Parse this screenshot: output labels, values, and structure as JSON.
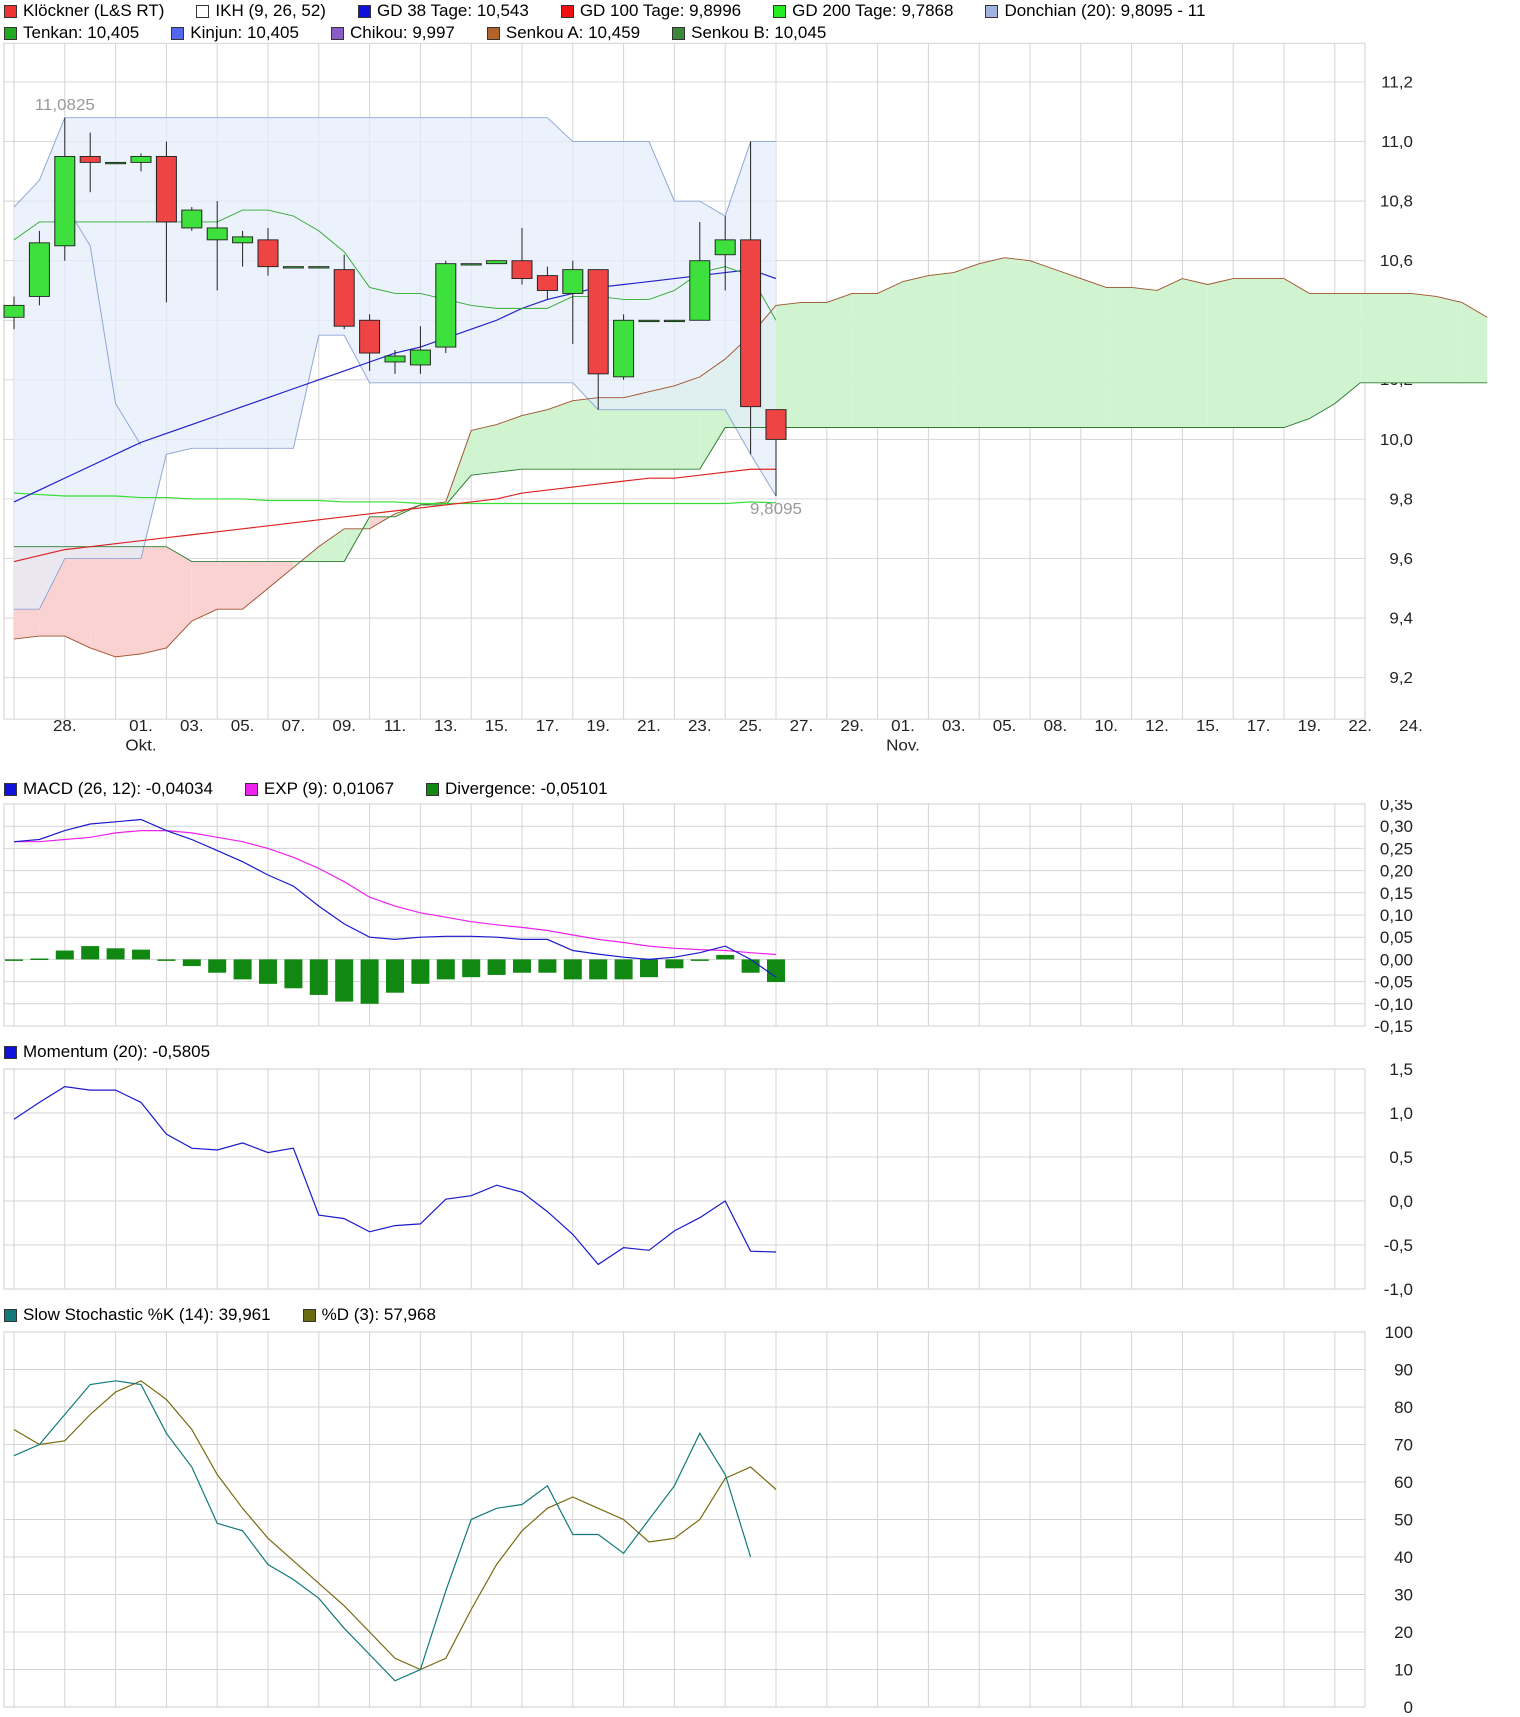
{
  "colors": {
    "bull": "#3de03d",
    "bear": "#ee4444",
    "gd38": "#2222cc",
    "gd100": "#dd2222",
    "gd200": "#33dd33",
    "donchian_fill": "#e6eefb",
    "donchian_line": "#8ea6d6",
    "tenkan": "#33aa33",
    "kumo_bull": "#d0f4d0",
    "kumo_bear": "#fbd2d2",
    "senkou_a": "#a0522d",
    "senkou_b": "#2e7d32",
    "macd": "#1a1acc",
    "exp": "#ee22ee",
    "divergence": "#118811",
    "momentum": "#1a1acc",
    "stoch_k": "#127a7a",
    "stoch_d": "#7a6a10",
    "grid": "#d4d4d4"
  },
  "legend": {
    "main_row1": [
      {
        "label": "Klöckner (L&S RT)",
        "color": "#ee3333"
      },
      {
        "label": "IKH (9, 26, 52)",
        "color": "#ffffff"
      },
      {
        "label": "GD 38 Tage: 10,543",
        "color": "#1111dd"
      },
      {
        "label": "GD 100 Tage: 9,8996",
        "color": "#ee1111"
      },
      {
        "label": "GD 200 Tage: 9,7868",
        "color": "#22ee22"
      },
      {
        "label": "Donchian (20): 9,8095 - 11",
        "color": "#9fb3dd"
      }
    ],
    "main_row2": [
      {
        "label": "Tenkan: 10,405",
        "color": "#22aa22"
      },
      {
        "label": "Kinjun: 10,405",
        "color": "#5566ee"
      },
      {
        "label": "Chikou: 9,997",
        "color": "#8a5cc8"
      },
      {
        "label": "Senkou A: 10,459",
        "color": "#b0642a"
      },
      {
        "label": "Senkou B: 10,045",
        "color": "#3a8a3a"
      }
    ],
    "macd": [
      {
        "label": "MACD (26, 12): -0,04034",
        "color": "#1111dd"
      },
      {
        "label": "EXP (9): 0,01067",
        "color": "#ee22ee"
      },
      {
        "label": "Divergence: -0,05101",
        "color": "#118811"
      }
    ],
    "momentum": [
      {
        "label": "Momentum (20): -0,5805",
        "color": "#1111dd"
      }
    ],
    "stoch": [
      {
        "label": "Slow Stochastic %K (14): 39,961",
        "color": "#127a7a"
      },
      {
        "label": "%D (3): 57,968",
        "color": "#6b6b10"
      }
    ]
  },
  "chart_data": [
    {
      "type": "candlestick",
      "name": "price",
      "ylim": [
        9.07,
        11.33
      ],
      "yticks": [
        "9,2",
        "9,4",
        "9,6",
        "9,8",
        "10,0",
        "10,2",
        "10,4",
        "10,6",
        "10,8",
        "11,0",
        "11,2"
      ],
      "ytick_values": [
        9.2,
        9.4,
        9.6,
        9.8,
        10.0,
        10.2,
        10.4,
        10.6,
        10.8,
        11.0,
        11.2
      ],
      "xlabels": [
        "28.",
        "01.",
        "03.",
        "05.",
        "07.",
        "09.",
        "11.",
        "13.",
        "15.",
        "17.",
        "19.",
        "21.",
        "23.",
        "25.",
        "27.",
        "29.",
        "01.",
        "03.",
        "05.",
        "08.",
        "10.",
        "12.",
        "15.",
        "17.",
        "19.",
        "22.",
        "24."
      ],
      "xlabel_slots": [
        2,
        5,
        7,
        9,
        11,
        13,
        15,
        17,
        19,
        21,
        23,
        25,
        27,
        29,
        31,
        33,
        35,
        37,
        39,
        41,
        43,
        45,
        47,
        49,
        51,
        53,
        55
      ],
      "month_labels": [
        {
          "label": "Okt.",
          "slot": 5
        },
        {
          "label": "Nov.",
          "slot": 35
        }
      ],
      "annotations": [
        {
          "text": "11,0825",
          "slot": 2,
          "value": 11.0825
        },
        {
          "text": "9,8095",
          "slot": 30,
          "value": 9.8095
        }
      ],
      "ohlc": [
        [
          10.41,
          10.48,
          10.37,
          10.45
        ],
        [
          10.48,
          10.7,
          10.45,
          10.66
        ],
        [
          10.65,
          11.08,
          10.6,
          10.95
        ],
        [
          10.95,
          11.03,
          10.83,
          10.93
        ],
        [
          10.93,
          10.93,
          10.93,
          10.93
        ],
        [
          10.93,
          10.96,
          10.9,
          10.95
        ],
        [
          10.95,
          11.0,
          10.46,
          10.73
        ],
        [
          10.71,
          10.78,
          10.7,
          10.77
        ],
        [
          10.67,
          10.8,
          10.5,
          10.71
        ],
        [
          10.66,
          10.7,
          10.58,
          10.68
        ],
        [
          10.67,
          10.71,
          10.55,
          10.58
        ],
        [
          10.58,
          10.58,
          10.58,
          10.58
        ],
        [
          10.58,
          10.58,
          10.58,
          10.58
        ],
        [
          10.57,
          10.62,
          10.37,
          10.38
        ],
        [
          10.4,
          10.42,
          10.23,
          10.29
        ],
        [
          10.26,
          10.3,
          10.22,
          10.28
        ],
        [
          10.25,
          10.38,
          10.22,
          10.3
        ],
        [
          10.31,
          10.6,
          10.29,
          10.59
        ],
        [
          10.59,
          10.59,
          10.59,
          10.59
        ],
        [
          10.59,
          10.6,
          10.59,
          10.6
        ],
        [
          10.6,
          10.71,
          10.52,
          10.54
        ],
        [
          10.55,
          10.58,
          10.47,
          10.5
        ],
        [
          10.49,
          10.6,
          10.32,
          10.57
        ],
        [
          10.57,
          10.57,
          10.1,
          10.22
        ],
        [
          10.21,
          10.42,
          10.2,
          10.4
        ],
        [
          10.4,
          10.4,
          10.4,
          10.4
        ],
        [
          10.4,
          10.4,
          10.4,
          10.4
        ],
        [
          10.4,
          10.73,
          10.4,
          10.6
        ],
        [
          10.62,
          10.75,
          10.5,
          10.67
        ],
        [
          10.67,
          11.0,
          9.95,
          10.11
        ],
        [
          10.1,
          10.1,
          9.81,
          10.0
        ]
      ],
      "gd38": [
        9.79,
        9.83,
        9.87,
        9.91,
        9.95,
        9.99,
        10.02,
        10.05,
        10.08,
        10.11,
        10.14,
        10.17,
        10.2,
        10.23,
        10.26,
        10.29,
        10.31,
        10.34,
        10.37,
        10.4,
        10.44,
        10.47,
        10.49,
        10.51,
        10.52,
        10.53,
        10.54,
        10.55,
        10.56,
        10.57,
        10.54
      ],
      "gd100": [
        9.59,
        9.61,
        9.63,
        9.64,
        9.65,
        9.66,
        9.67,
        9.68,
        9.69,
        9.7,
        9.71,
        9.72,
        9.73,
        9.74,
        9.75,
        9.76,
        9.77,
        9.78,
        9.79,
        9.8,
        9.82,
        9.83,
        9.84,
        9.85,
        9.86,
        9.87,
        9.87,
        9.88,
        9.89,
        9.9,
        9.9
      ],
      "gd200": [
        9.82,
        9.815,
        9.81,
        9.81,
        9.81,
        9.805,
        9.805,
        9.8,
        9.8,
        9.8,
        9.795,
        9.795,
        9.795,
        9.79,
        9.79,
        9.79,
        9.785,
        9.785,
        9.785,
        9.785,
        9.785,
        9.785,
        9.785,
        9.785,
        9.785,
        9.785,
        9.785,
        9.785,
        9.785,
        9.79,
        9.787
      ],
      "donchian_upper": [
        10.78,
        10.87,
        11.08,
        11.08,
        11.08,
        11.08,
        11.08,
        11.08,
        11.08,
        11.08,
        11.08,
        11.08,
        11.08,
        11.08,
        11.08,
        11.08,
        11.08,
        11.08,
        11.08,
        11.08,
        11.08,
        11.08,
        11.0,
        11.0,
        11.0,
        11.0,
        10.8,
        10.8,
        10.75,
        11.0,
        11.0
      ],
      "donchian_lower": [
        9.43,
        9.43,
        9.6,
        9.6,
        9.6,
        9.6,
        9.95,
        9.97,
        9.97,
        9.97,
        9.97,
        9.97,
        10.35,
        10.35,
        10.19,
        10.19,
        10.19,
        10.19,
        10.19,
        10.19,
        10.19,
        10.19,
        10.19,
        10.1,
        10.1,
        10.1,
        10.1,
        10.1,
        10.1,
        9.95,
        9.81
      ],
      "tenkan": [
        10.67,
        10.73,
        10.73,
        10.73,
        10.73,
        10.73,
        10.73,
        10.73,
        10.73,
        10.77,
        10.77,
        10.75,
        10.7,
        10.63,
        10.51,
        10.49,
        10.49,
        10.47,
        10.45,
        10.44,
        10.44,
        10.44,
        10.48,
        10.48,
        10.47,
        10.47,
        10.5,
        10.56,
        10.58,
        10.55,
        10.4
      ],
      "donchian_mid_early": [
        10.79,
        10.65,
        10.12,
        9.98
      ],
      "senkou_a": [
        9.33,
        9.34,
        9.34,
        9.3,
        9.27,
        9.28,
        9.3,
        9.39,
        9.43,
        9.43,
        9.5,
        9.57,
        9.64,
        9.7,
        9.7,
        9.75,
        9.78,
        9.79,
        10.03,
        10.05,
        10.08,
        10.1,
        10.13,
        10.14,
        10.14,
        10.16,
        10.18,
        10.21,
        10.27,
        10.35,
        10.45,
        10.46,
        10.46,
        10.49,
        10.49,
        10.53,
        10.55,
        10.56,
        10.59,
        10.61,
        10.6,
        10.57,
        10.54,
        10.51,
        10.51,
        10.5,
        10.54,
        10.52,
        10.54,
        10.54,
        10.54,
        10.49,
        10.49,
        10.49,
        10.49,
        10.49,
        10.48,
        10.46,
        10.41
      ],
      "senkou_b": [
        9.64,
        9.64,
        9.64,
        9.64,
        9.64,
        9.64,
        9.64,
        9.59,
        9.59,
        9.59,
        9.59,
        9.59,
        9.59,
        9.59,
        9.74,
        9.74,
        9.78,
        9.78,
        9.88,
        9.89,
        9.9,
        9.9,
        9.9,
        9.9,
        9.9,
        9.9,
        9.9,
        9.9,
        10.04,
        10.04,
        10.04,
        10.04,
        10.04,
        10.04,
        10.04,
        10.04,
        10.04,
        10.04,
        10.04,
        10.04,
        10.04,
        10.04,
        10.04,
        10.04,
        10.04,
        10.04,
        10.04,
        10.04,
        10.04,
        10.04,
        10.04,
        10.07,
        10.12,
        10.19,
        10.19,
        10.19,
        10.19,
        10.19,
        10.19
      ]
    },
    {
      "type": "line+bar",
      "name": "macd",
      "ylim": [
        -0.15,
        0.35
      ],
      "yticks": [
        "-0,15",
        "-0,10",
        "-0,05",
        "0,00",
        "0,05",
        "0,10",
        "0,15",
        "0,20",
        "0,25",
        "0,30",
        "0,35"
      ],
      "ytick_values": [
        -0.15,
        -0.1,
        -0.05,
        0.0,
        0.05,
        0.1,
        0.15,
        0.2,
        0.25,
        0.3,
        0.35
      ],
      "macd": [
        0.265,
        0.27,
        0.29,
        0.305,
        0.31,
        0.315,
        0.29,
        0.27,
        0.245,
        0.22,
        0.19,
        0.165,
        0.12,
        0.08,
        0.05,
        0.045,
        0.05,
        0.052,
        0.052,
        0.05,
        0.045,
        0.045,
        0.02,
        0.012,
        0.005,
        0.0,
        0.005,
        0.015,
        0.03,
        0.0,
        -0.04
      ],
      "exp": [
        0.265,
        0.265,
        0.27,
        0.275,
        0.285,
        0.29,
        0.29,
        0.285,
        0.275,
        0.265,
        0.25,
        0.23,
        0.205,
        0.175,
        0.14,
        0.12,
        0.105,
        0.095,
        0.085,
        0.078,
        0.072,
        0.065,
        0.055,
        0.045,
        0.038,
        0.03,
        0.025,
        0.022,
        0.02,
        0.015,
        0.011
      ],
      "divergence": [
        0.0,
        0.002,
        0.02,
        0.03,
        0.025,
        0.022,
        0.0,
        -0.015,
        -0.03,
        -0.045,
        -0.055,
        -0.065,
        -0.08,
        -0.095,
        -0.1,
        -0.075,
        -0.055,
        -0.045,
        -0.04,
        -0.035,
        -0.03,
        -0.03,
        -0.045,
        -0.045,
        -0.045,
        -0.04,
        -0.02,
        0.0,
        0.01,
        -0.03,
        -0.051
      ]
    },
    {
      "type": "line",
      "name": "momentum",
      "ylim": [
        -1.0,
        1.5
      ],
      "yticks": [
        "-1,0",
        "-0,5",
        "0,0",
        "0,5",
        "1,0",
        "1,5"
      ],
      "ytick_values": [
        -1.0,
        -0.5,
        0.0,
        0.5,
        1.0,
        1.5
      ],
      "values": [
        0.93,
        1.12,
        1.3,
        1.26,
        1.26,
        1.12,
        0.76,
        0.6,
        0.58,
        0.66,
        0.55,
        0.6,
        -0.16,
        -0.2,
        -0.35,
        -0.28,
        -0.26,
        0.02,
        0.06,
        0.18,
        0.1,
        -0.12,
        -0.38,
        -0.72,
        -0.53,
        -0.56,
        -0.34,
        -0.19,
        0.0,
        -0.57,
        -0.58
      ]
    },
    {
      "type": "line",
      "name": "slow_stochastic",
      "ylim": [
        0,
        100
      ],
      "yticks": [
        "0",
        "10",
        "20",
        "30",
        "40",
        "50",
        "60",
        "70",
        "80",
        "90",
        "100"
      ],
      "ytick_values": [
        0,
        10,
        20,
        30,
        40,
        50,
        60,
        70,
        80,
        90,
        100
      ],
      "k": [
        67,
        70,
        78,
        86,
        87,
        86,
        73,
        64,
        49,
        47,
        38,
        34,
        29,
        21,
        14,
        7,
        10,
        31,
        50,
        53,
        54,
        59,
        46,
        46,
        41,
        50,
        59,
        73,
        62,
        40
      ],
      "d": [
        74,
        70,
        71,
        78,
        84,
        87,
        82,
        74,
        62,
        53,
        45,
        39,
        33,
        27,
        20,
        13,
        10,
        13,
        26,
        38,
        47,
        53,
        56,
        53,
        50,
        44,
        45,
        50,
        61,
        64,
        58
      ]
    }
  ]
}
